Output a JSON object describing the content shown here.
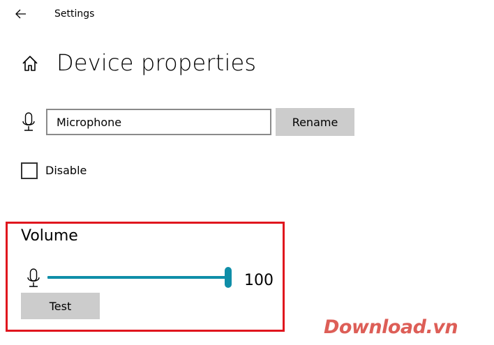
{
  "app": {
    "title": "Settings"
  },
  "page": {
    "title": "Device properties"
  },
  "device": {
    "name_value": "Microphone",
    "rename_label": "Rename",
    "disable_label": "Disable",
    "disable_checked": false
  },
  "volume": {
    "section_title": "Volume",
    "value": "100",
    "level_fraction": 1.0,
    "test_label": "Test",
    "accent_color": "#0f8ea8"
  },
  "highlight_color": "#e0161e",
  "watermark": {
    "text": "Download.vn",
    "color": "#d8433a"
  },
  "icons": {
    "back": "back-arrow-icon",
    "home": "home-icon",
    "mic": "microphone-icon"
  }
}
